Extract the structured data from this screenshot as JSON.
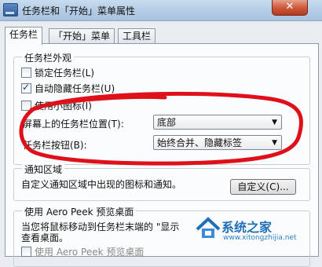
{
  "window": {
    "title": "任务栏和「开始」菜单属性",
    "close_label": "✕"
  },
  "tabs": [
    {
      "label": "任务栏",
      "active": true
    },
    {
      "label": "「开始」菜单",
      "active": false
    },
    {
      "label": "工具栏",
      "active": false
    }
  ],
  "appearance": {
    "group_label": "任务栏外观",
    "lock_taskbar": {
      "label": "锁定任务栏(L)",
      "checked": false
    },
    "auto_hide": {
      "label": "自动隐藏任务栏(U)",
      "checked": true
    },
    "small_icons": {
      "label": "使用小图标(I)",
      "checked": false
    },
    "location_label": "屏幕上的任务栏位置(T):",
    "location_value": "底部",
    "buttons_label": "任务栏按钮(B):",
    "buttons_value": "始终合并、隐藏标签"
  },
  "notification": {
    "group_label": "通知区域",
    "desc": "自定义通知区域中出现的图标和通知。",
    "customize_button": "自定义(C)..."
  },
  "peek": {
    "group_label": "使用 Aero Peek 预览桌面",
    "desc_line1": "当您将鼠标移动到任务栏末端的 \"显示",
    "desc_line2": "查看桌面。",
    "checkbox_label": "使用 Aero Peek 预览桌面"
  },
  "watermark": {
    "text": "系统之家",
    "url": "www.xitongzhijia.net"
  },
  "colors": {
    "annotation": "#e0101a",
    "accent": "#1f6fb9"
  }
}
